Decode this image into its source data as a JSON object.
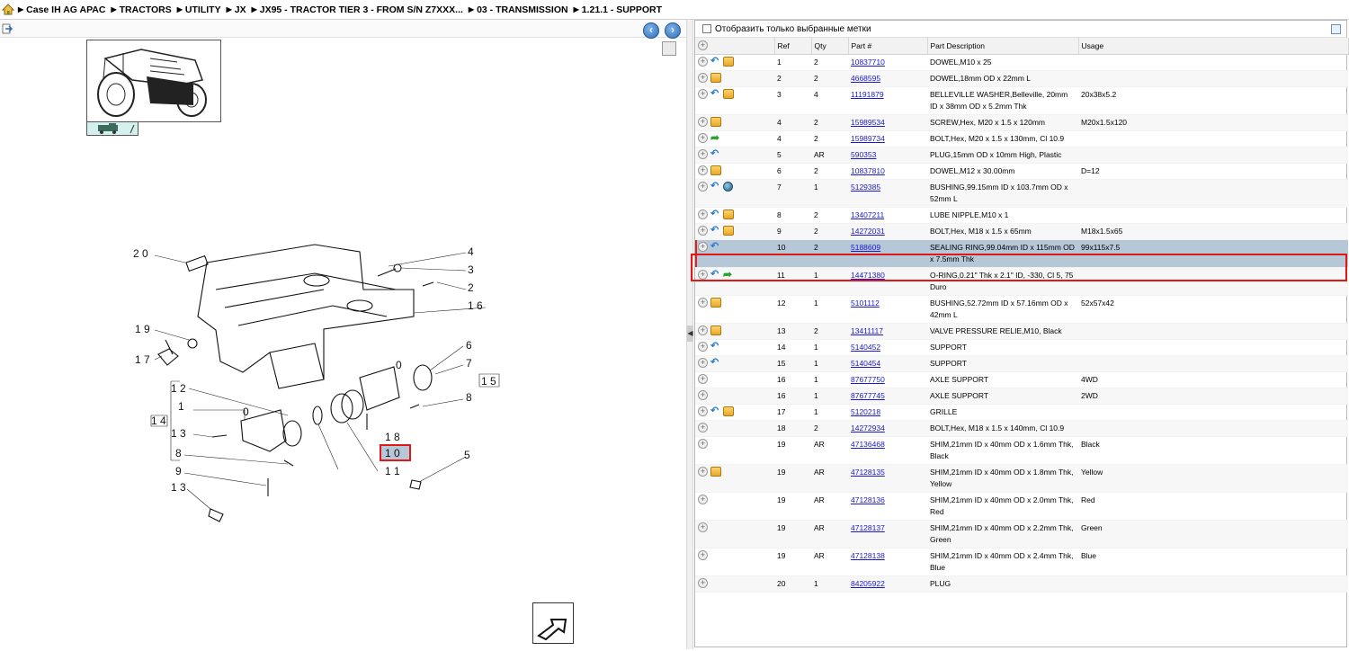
{
  "breadcrumb": [
    "Case IH AG APAC",
    "TRACTORS",
    "UTILITY",
    "JX",
    "JX95 - TRACTOR TIER 3 - FROM S/N Z7XXX...",
    "03 - TRANSMISSION",
    "1.21.1 - SUPPORT"
  ],
  "filter_label": "Отобразить только выбранные метки",
  "columns": [
    "Ref",
    "Qty",
    "Part #",
    "Part Description",
    "Usage"
  ],
  "rows": [
    {
      "ref": "1",
      "qty": "2",
      "part": "10837710",
      "desc": "DOWEL,M10 x 25",
      "usage": "",
      "icons": [
        "plus",
        "swap",
        "box"
      ]
    },
    {
      "ref": "2",
      "qty": "2",
      "part": "4668595",
      "desc": "DOWEL,18mm OD x 22mm L",
      "usage": "",
      "icons": [
        "plus",
        "box"
      ]
    },
    {
      "ref": "3",
      "qty": "4",
      "part": "11191879",
      "desc": "BELLEVILLE WASHER,Belleville, 20mm ID x 38mm OD x 5.2mm Thk",
      "usage": "20x38x5.2",
      "icons": [
        "plus",
        "swap",
        "box"
      ]
    },
    {
      "ref": "4",
      "qty": "2",
      "part": "15989534",
      "desc": "SCREW,Hex, M20 x 1.5 x 120mm",
      "usage": "M20x1.5x120",
      "icons": [
        "plus",
        "box"
      ]
    },
    {
      "ref": "4",
      "qty": "2",
      "part": "15989734",
      "desc": "BOLT,Hex, M20 x 1.5 x 130mm, Cl 10.9",
      "usage": "",
      "icons": [
        "plus",
        "green"
      ]
    },
    {
      "ref": "5",
      "qty": "AR",
      "part": "590353",
      "desc": "PLUG,15mm OD x 10mm High, Plastic",
      "usage": "",
      "icons": [
        "plus",
        "swap"
      ]
    },
    {
      "ref": "6",
      "qty": "2",
      "part": "10837810",
      "desc": "DOWEL,M12 x 30.00mm",
      "usage": "D=12",
      "icons": [
        "plus",
        "box"
      ]
    },
    {
      "ref": "7",
      "qty": "1",
      "part": "5129385",
      "desc": "BUSHING,99.15mm ID x 103.7mm OD x 52mm L",
      "usage": "",
      "icons": [
        "plus",
        "swap",
        "globe"
      ]
    },
    {
      "ref": "8",
      "qty": "2",
      "part": "13407211",
      "desc": "LUBE NIPPLE,M10 x 1",
      "usage": "",
      "icons": [
        "plus",
        "swap",
        "box"
      ]
    },
    {
      "ref": "9",
      "qty": "2",
      "part": "14272031",
      "desc": "BOLT,Hex, M18 x 1.5 x 65mm",
      "usage": "M18x1.5x65",
      "icons": [
        "plus",
        "swap",
        "box"
      ]
    },
    {
      "ref": "10",
      "qty": "2",
      "part": "5188609",
      "desc": "SEALING RING,99.04mm ID x 115mm OD x 7.5mm Thk",
      "usage": "99x115x7.5",
      "icons": [
        "plus",
        "swap"
      ],
      "selected": true
    },
    {
      "ref": "11",
      "qty": "1",
      "part": "14471380",
      "desc": "O-RING,0.21\" Thk x 2.1\" ID, -330, Cl 5, 75 Duro",
      "usage": "",
      "icons": [
        "plus",
        "swap",
        "green"
      ]
    },
    {
      "ref": "12",
      "qty": "1",
      "part": "5101112",
      "desc": "BUSHING,52.72mm ID x 57.16mm OD x 42mm L",
      "usage": "52x57x42",
      "icons": [
        "plus",
        "box"
      ]
    },
    {
      "ref": "13",
      "qty": "2",
      "part": "13411117",
      "desc": "VALVE PRESSURE RELIE,M10, Black",
      "usage": "",
      "icons": [
        "plus",
        "box"
      ]
    },
    {
      "ref": "14",
      "qty": "1",
      "part": "5140452",
      "desc": "SUPPORT",
      "usage": "",
      "icons": [
        "plus",
        "swap"
      ]
    },
    {
      "ref": "15",
      "qty": "1",
      "part": "5140454",
      "desc": "SUPPORT",
      "usage": "",
      "icons": [
        "plus",
        "swap"
      ]
    },
    {
      "ref": "16",
      "qty": "1",
      "part": "87677750",
      "desc": "AXLE SUPPORT",
      "usage": "4WD",
      "icons": [
        "plus"
      ]
    },
    {
      "ref": "16",
      "qty": "1",
      "part": "87677745",
      "desc": "AXLE SUPPORT",
      "usage": "2WD",
      "icons": [
        "plus"
      ]
    },
    {
      "ref": "17",
      "qty": "1",
      "part": "5120218",
      "desc": "GRILLE",
      "usage": "",
      "icons": [
        "plus",
        "swap",
        "box"
      ]
    },
    {
      "ref": "18",
      "qty": "2",
      "part": "14272934",
      "desc": "BOLT,Hex, M18 x 1.5 x 140mm, Cl 10.9",
      "usage": "",
      "icons": [
        "plus"
      ]
    },
    {
      "ref": "19",
      "qty": "AR",
      "part": "47136468",
      "desc": "SHIM,21mm ID x 40mm OD x 1.6mm Thk, Black",
      "usage": "Black",
      "icons": [
        "plus"
      ]
    },
    {
      "ref": "19",
      "qty": "AR",
      "part": "47128135",
      "desc": "SHIM,21mm ID x 40mm OD x 1.8mm Thk, Yellow",
      "usage": "Yellow",
      "icons": [
        "plus",
        "box"
      ]
    },
    {
      "ref": "19",
      "qty": "AR",
      "part": "47128136",
      "desc": "SHIM,21mm ID x 40mm OD x 2.0mm Thk, Red",
      "usage": "Red",
      "icons": [
        "plus"
      ]
    },
    {
      "ref": "19",
      "qty": "AR",
      "part": "47128137",
      "desc": "SHIM,21mm ID x 40mm OD x 2.2mm Thk, Green",
      "usage": "Green",
      "icons": [
        "plus"
      ]
    },
    {
      "ref": "19",
      "qty": "AR",
      "part": "47128138",
      "desc": "SHIM,21mm ID x 40mm OD x 2.4mm Thk, Blue",
      "usage": "Blue",
      "icons": [
        "plus"
      ]
    },
    {
      "ref": "20",
      "qty": "1",
      "part": "84205922",
      "desc": "PLUG",
      "usage": "",
      "icons": [
        "plus"
      ]
    }
  ],
  "diagram_callouts": [
    "2 0",
    "1 9",
    "1 7",
    "1 2",
    "1",
    "1 4",
    "1 3",
    "8",
    "9",
    "1 3",
    "4",
    "3",
    "2",
    "1 6",
    "6",
    "0",
    "7",
    "1 5",
    "8",
    "1 8",
    "1 0",
    "1 1",
    "5",
    "0"
  ],
  "selected_callout": "1 0"
}
